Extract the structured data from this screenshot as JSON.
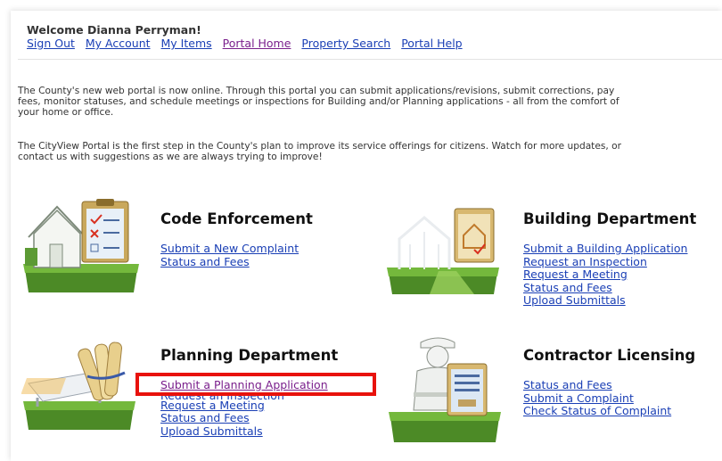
{
  "header": {
    "welcome": "Welcome Dianna Perryman!",
    "nav": [
      "Sign Out",
      "My Account",
      "My Items",
      "Portal Home",
      "Property Search",
      "Portal Help"
    ]
  },
  "intro": {
    "p1_lines": [
      "The County's new web portal is now online. Through this portal you can submit applications/revisions, submit corrections, pay",
      "fees, monitor statuses, and schedule meetings or inspections for Building and/or Planning applications - all from the comfort of",
      "your home or office."
    ],
    "p2_lines": [
      "The CityView Portal is the first step in the County's plan to improve its service offerings for citizens. Watch for more updates, or",
      "contact us with suggestions as we are always trying to improve!"
    ]
  },
  "sections": {
    "code_enforcement": {
      "title": "Code Enforcement",
      "links": [
        "Submit a New Complaint",
        "Status and Fees"
      ]
    },
    "building": {
      "title": "Building Department",
      "links": [
        "Submit a Building Application",
        "Request an Inspection",
        "Request a Meeting",
        "Status and Fees",
        "Upload Submittals"
      ]
    },
    "planning": {
      "title": "Planning Department",
      "links": [
        "Submit a Planning Application",
        "Request an Inspection",
        "Request a Meeting",
        "Status and Fees",
        "Upload Submittals"
      ]
    },
    "contractor": {
      "title": "Contractor Licensing",
      "links": [
        "Status and Fees",
        "Submit a Complaint",
        "Check Status of Complaint"
      ]
    }
  },
  "icons": {
    "code_enforcement": "house-clipboard-icon",
    "building": "building-frame-icon",
    "planning": "blueprint-table-icon",
    "contractor": "contractor-worker-icon"
  },
  "colors": {
    "link": "#1a3fb5",
    "visited_link": "#7a1f8c",
    "highlight": "#e8120c",
    "grass": "#5a9e2e"
  }
}
